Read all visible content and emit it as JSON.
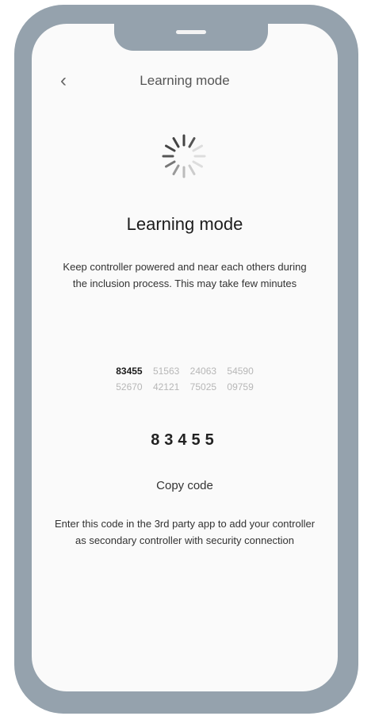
{
  "header": {
    "title": "Learning mode",
    "back_icon": "chevron-left-icon"
  },
  "main": {
    "heading": "Learning mode",
    "description": "Keep controller powered and near each others during the inclusion process. This may take few minutes",
    "code_row1": [
      "83455",
      "51563",
      "24063",
      "54590"
    ],
    "code_row2": [
      "52670",
      "42121",
      "75025",
      "09759"
    ],
    "code": "83455",
    "copy_label": "Copy code",
    "instructions": "Enter this code in the 3rd party app to add your controller as secondary controller with security connection"
  },
  "colors": {
    "frame": "#95a2ad",
    "screen": "#fafafa",
    "text": "#333333"
  }
}
